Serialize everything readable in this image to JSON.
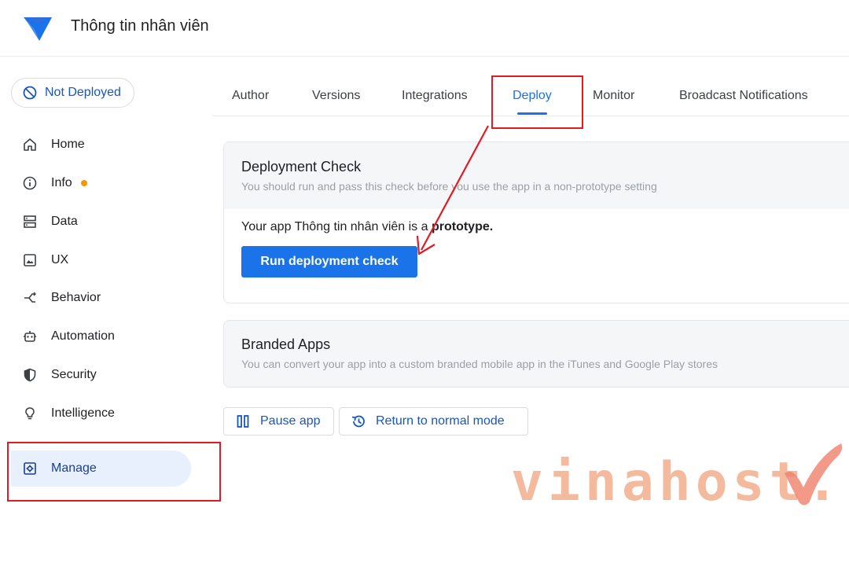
{
  "app": {
    "title": "Thông tin nhân viên",
    "logo_icon": "appsheet-logo-icon",
    "brand_color": "#1a73e8"
  },
  "status": {
    "label": "Not Deployed",
    "icon": "not-deployed-icon"
  },
  "tabs": [
    {
      "label": "Author",
      "active": false
    },
    {
      "label": "Versions",
      "active": false
    },
    {
      "label": "Integrations",
      "active": false
    },
    {
      "label": "Deploy",
      "active": true
    },
    {
      "label": "Monitor",
      "active": false
    },
    {
      "label": "Broadcast Notifications",
      "active": false
    }
  ],
  "sidebar": {
    "items": [
      {
        "label": "Home",
        "icon": "home-icon"
      },
      {
        "label": "Info",
        "icon": "info-icon",
        "badge_color": "#f29900"
      },
      {
        "label": "Data",
        "icon": "data-icon"
      },
      {
        "label": "UX",
        "icon": "ux-icon"
      },
      {
        "label": "Behavior",
        "icon": "behavior-icon"
      },
      {
        "label": "Automation",
        "icon": "robot-icon"
      },
      {
        "label": "Security",
        "icon": "shield-icon"
      },
      {
        "label": "Intelligence",
        "icon": "lightbulb-icon"
      },
      {
        "label": "Manage",
        "icon": "gear-icon",
        "active": true
      }
    ]
  },
  "deployment_check": {
    "title": "Deployment Check",
    "subtitle": "You should run and pass this check before you use the app in a non-prototype setting",
    "message_prefix": "Your app Thông tin nhân viên is a",
    "message_bold": "prototype.",
    "button_label": "Run deployment check"
  },
  "branded_apps": {
    "title": "Branded Apps",
    "subtitle": "You can convert your app into a custom branded mobile app in the iTunes and Google Play stores"
  },
  "actions": {
    "pause_label": "Pause app",
    "return_label": "Return to normal mode"
  },
  "watermark": {
    "text": "vinahost.",
    "color": "#f0a37e"
  },
  "annotation_color": "#e01b24"
}
